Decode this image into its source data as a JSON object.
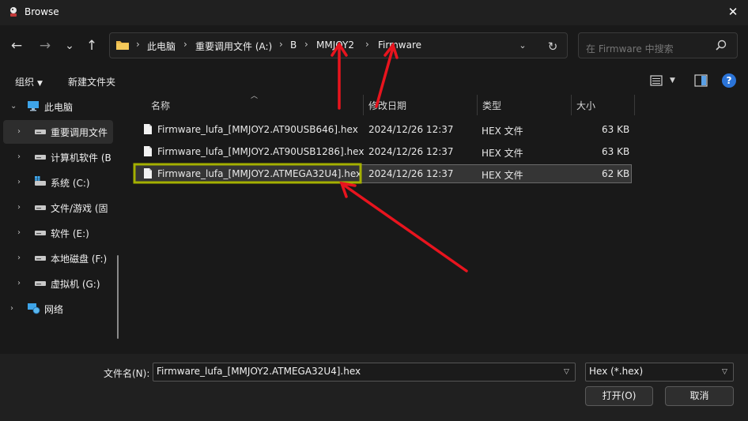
{
  "window": {
    "title": "Browse"
  },
  "nav": {
    "back": "←",
    "forward": "→",
    "recent": "⌄",
    "up": "↑",
    "breadcrumbs": [
      "此电脑",
      "重要调用文件 (A:)",
      "B",
      "MMJOY2",
      "Firmware"
    ],
    "refresh": "↻",
    "search_placeholder": "在 Firmware 中搜索"
  },
  "toolbar": {
    "organize": "组织",
    "new_folder": "新建文件夹",
    "help": "?"
  },
  "sidebar": {
    "items": [
      {
        "label": "此电脑",
        "icon": "pc-icon"
      },
      {
        "label": "重要调用文件",
        "icon": "drive-icon"
      },
      {
        "label": "计算机软件 (B",
        "icon": "drive-icon"
      },
      {
        "label": "系统 (C:)",
        "icon": "windows-drive-icon"
      },
      {
        "label": "文件/游戏 (固",
        "icon": "drive-icon"
      },
      {
        "label": "软件 (E:)",
        "icon": "drive-icon"
      },
      {
        "label": "本地磁盘 (F:)",
        "icon": "drive-icon"
      },
      {
        "label": "虚拟机 (G:)",
        "icon": "drive-icon"
      },
      {
        "label": "网络",
        "icon": "network-icon"
      }
    ]
  },
  "columns": {
    "name": "名称",
    "modified": "修改日期",
    "type": "类型",
    "size": "大小"
  },
  "files": [
    {
      "name": "Firmware_lufa_[MMJOY2.AT90USB646].hex",
      "modified": "2024/12/26 12:37",
      "type": "HEX 文件",
      "size": "63 KB"
    },
    {
      "name": "Firmware_lufa_[MMJOY2.AT90USB1286].hex",
      "modified": "2024/12/26 12:37",
      "type": "HEX 文件",
      "size": "63 KB"
    },
    {
      "name": "Firmware_lufa_[MMJOY2.ATMEGA32U4].hex",
      "modified": "2024/12/26 12:37",
      "type": "HEX 文件",
      "size": "62 KB"
    }
  ],
  "footer": {
    "filename_label": "文件名(N):",
    "filename_value": "Firmware_lufa_[MMJOY2.ATMEGA32U4].hex",
    "filetype": "Hex (*.hex)",
    "open": "打开(O)",
    "cancel": "取消"
  },
  "colors": {
    "annotation_arrow": "#e8141e",
    "highlight_box": "#a4b000"
  }
}
